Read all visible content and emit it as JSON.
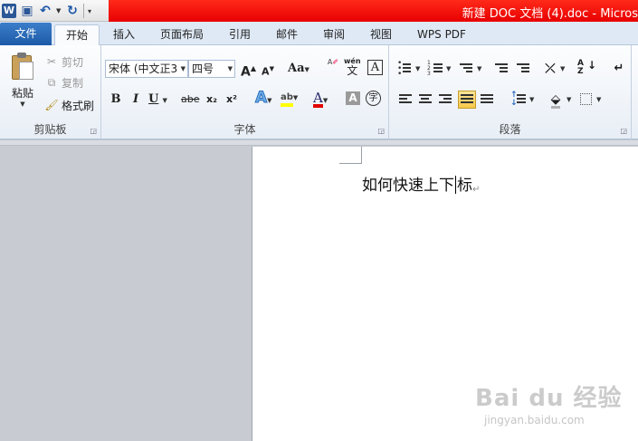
{
  "quick_access": {
    "app_badge": "W",
    "more_glyph": "▾"
  },
  "window": {
    "title": "新建 DOC 文档 (4).doc - Micros"
  },
  "tabs": [
    {
      "label": "文件"
    },
    {
      "label": "开始"
    },
    {
      "label": "插入"
    },
    {
      "label": "页面布局"
    },
    {
      "label": "引用"
    },
    {
      "label": "邮件"
    },
    {
      "label": "审阅"
    },
    {
      "label": "视图"
    },
    {
      "label": "WPS PDF"
    }
  ],
  "clipboard": {
    "paste": "粘贴",
    "cut": "剪切",
    "copy": "复制",
    "format_painter": "格式刷",
    "group_label": "剪贴板"
  },
  "font": {
    "font_name": "宋体 (中文正3",
    "font_size": "四号",
    "grow": "A",
    "shrink": "A",
    "change_case": "Aa",
    "pinyin_top": "wén",
    "pinyin_char": "文",
    "border_char": "A",
    "bold": "B",
    "italic": "I",
    "underline": "U",
    "strike": "abe",
    "subscript": "x₂",
    "superscript": "x²",
    "text_effects": "A",
    "highlight": "ab",
    "font_color": "A",
    "char_shading": "A",
    "enclose": "字",
    "group_label": "字体"
  },
  "paragraph": {
    "group_label": "段落"
  },
  "document": {
    "text_before_caret": "如何快速上下",
    "text_after_caret": "标",
    "para_mark": "↵"
  },
  "watermark": {
    "main": "Bai du 经验",
    "sub": "jingyan.baidu.com"
  },
  "colors": {
    "title_bar": "#ff1a0a",
    "file_tab": "#2a6cbc",
    "highlight_yellow": "#ffff00",
    "font_red": "#e00000",
    "selected_align": "#f7c94a"
  }
}
